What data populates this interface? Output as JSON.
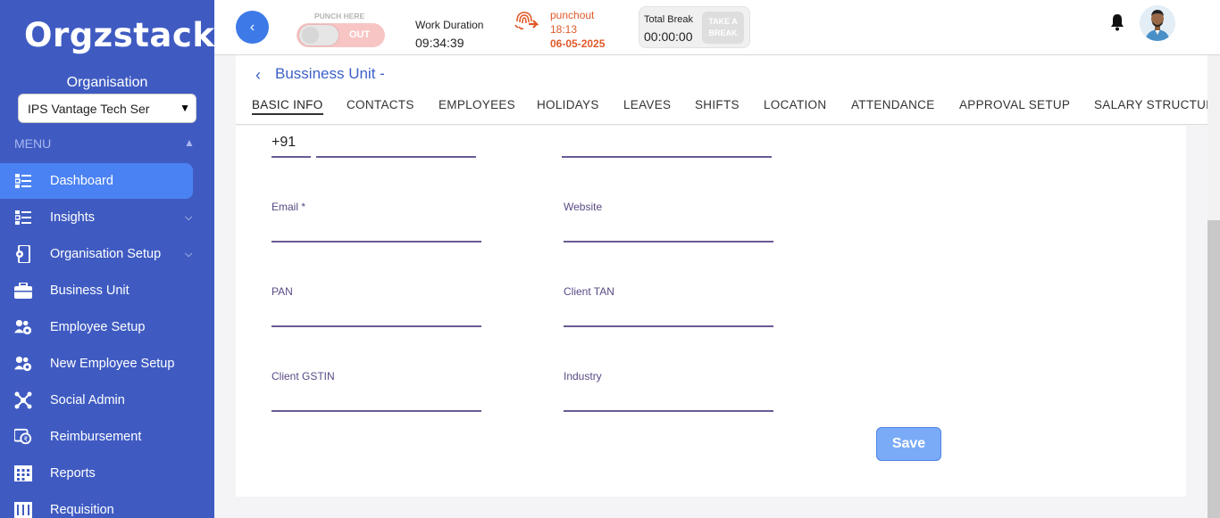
{
  "brand": {
    "logo_text": "Orgzstack"
  },
  "sidebar": {
    "org_label": "Organisation",
    "org_select_value": "IPS Vantage Tech Ser",
    "menu_label": "MENU",
    "items": [
      {
        "label": "Dashboard",
        "icon": "dashboard-icon",
        "active": true
      },
      {
        "label": "Insights",
        "icon": "insights-icon",
        "has_chevron": true
      },
      {
        "label": "Organisation Setup",
        "icon": "organisation-setup-icon",
        "has_chevron": true
      },
      {
        "label": "Business Unit",
        "icon": "briefcase-icon"
      },
      {
        "label": "Employee Setup",
        "icon": "employee-setup-icon"
      },
      {
        "label": "New Employee Setup",
        "icon": "new-employee-setup-icon"
      },
      {
        "label": "Social Admin",
        "icon": "social-admin-icon"
      },
      {
        "label": "Reimbursement",
        "icon": "reimbursement-icon"
      },
      {
        "label": "Reports",
        "icon": "reports-icon"
      },
      {
        "label": "Requisition",
        "icon": "requisition-icon"
      }
    ]
  },
  "topbar": {
    "punch_here_label": "PUNCH HERE",
    "toggle_state": "OUT",
    "work_duration_label": "Work Duration",
    "work_duration_value": "09:34:39",
    "punchout_label": "punchout",
    "punchout_time": "18:13",
    "punchout_date": "06-05-2025",
    "total_break_label": "Total Break",
    "total_break_value": "00:00:00",
    "take_break_line1": "TAKE A",
    "take_break_line2": "BREAK"
  },
  "page": {
    "title": "Bussiness Unit -",
    "tabs": [
      {
        "label": "BASIC INFO",
        "active": true
      },
      {
        "label": "CONTACTS"
      },
      {
        "label": "EMPLOYEES"
      },
      {
        "label": "HOLIDAYS"
      },
      {
        "label": "LEAVES"
      },
      {
        "label": "SHIFTS"
      },
      {
        "label": "LOCATION"
      },
      {
        "label": "ATTENDANCE"
      },
      {
        "label": "APPROVAL SETUP"
      },
      {
        "label": "SALARY STRUCTURE"
      }
    ]
  },
  "form": {
    "phone_code": "+91",
    "email_label": "Email *",
    "website_label": "Website",
    "pan_label": "PAN",
    "client_tan_label": "Client TAN",
    "client_gstin_label": "Client GSTIN",
    "industry_label": "Industry",
    "save_label": "Save"
  },
  "colors": {
    "sidebar_bg": "#3f5bc2",
    "active_item": "#4b82f3",
    "accent": "#3d60c8",
    "punchout": "#e05a2a",
    "save_button": "#7aabf7"
  }
}
